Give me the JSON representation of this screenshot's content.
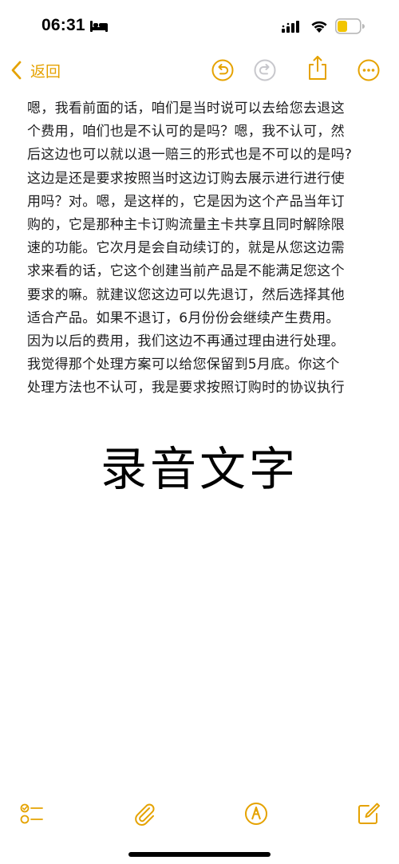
{
  "status_bar": {
    "time": "06:31",
    "sleep_icon": "bed-icon",
    "signal_icon": "cellular-signal-icon",
    "wifi_icon": "wifi-icon",
    "battery_icon": "battery-low-power-icon",
    "battery_color": "#f2c500"
  },
  "nav": {
    "back_label": "返回",
    "accent_color": "#e5a200",
    "undo_icon": "undo-icon",
    "redo_icon": "redo-icon",
    "share_icon": "share-icon",
    "more_icon": "ellipsis-circle-icon"
  },
  "note": {
    "lines": [
      "嗯，我看前面的话，咱们是当时说可以去给您去退这",
      "个费用，咱们也是不认可的是吗？嗯，我不认可，然",
      "后这边也可以就以退一赔三的形式也是不可以的是吗?",
      "这边是还是要求按照当时这边订购去展示进行进行使",
      "用吗？对。嗯，是这样的，它是因为这个产品当年订",
      "购的，它是那种主卡订购流量主卡共享且同时解除限",
      "速的功能。它次月是会自动续订的，就是从您这边需",
      "求来看的话，它这个创建当前产品是不能满足您这个",
      "要求的嘛。就建议您这边可以先退订，然后选择其他",
      "适合产品。如果不退订，6月份份会继续产生费用。",
      "因为以后的费用，我们这边不再通过理由进行处理。",
      "我觉得那个处理方案可以给您保留到5月底。你这个",
      "处理方法也不认可，我是要求按照订购时的协议执行"
    ],
    "overlay_title": "录音文字"
  },
  "bottom_toolbar": {
    "checklist_icon": "checklist-icon",
    "attach_icon": "paperclip-icon",
    "markup_icon": "markup-pen-icon",
    "compose_icon": "compose-icon"
  }
}
